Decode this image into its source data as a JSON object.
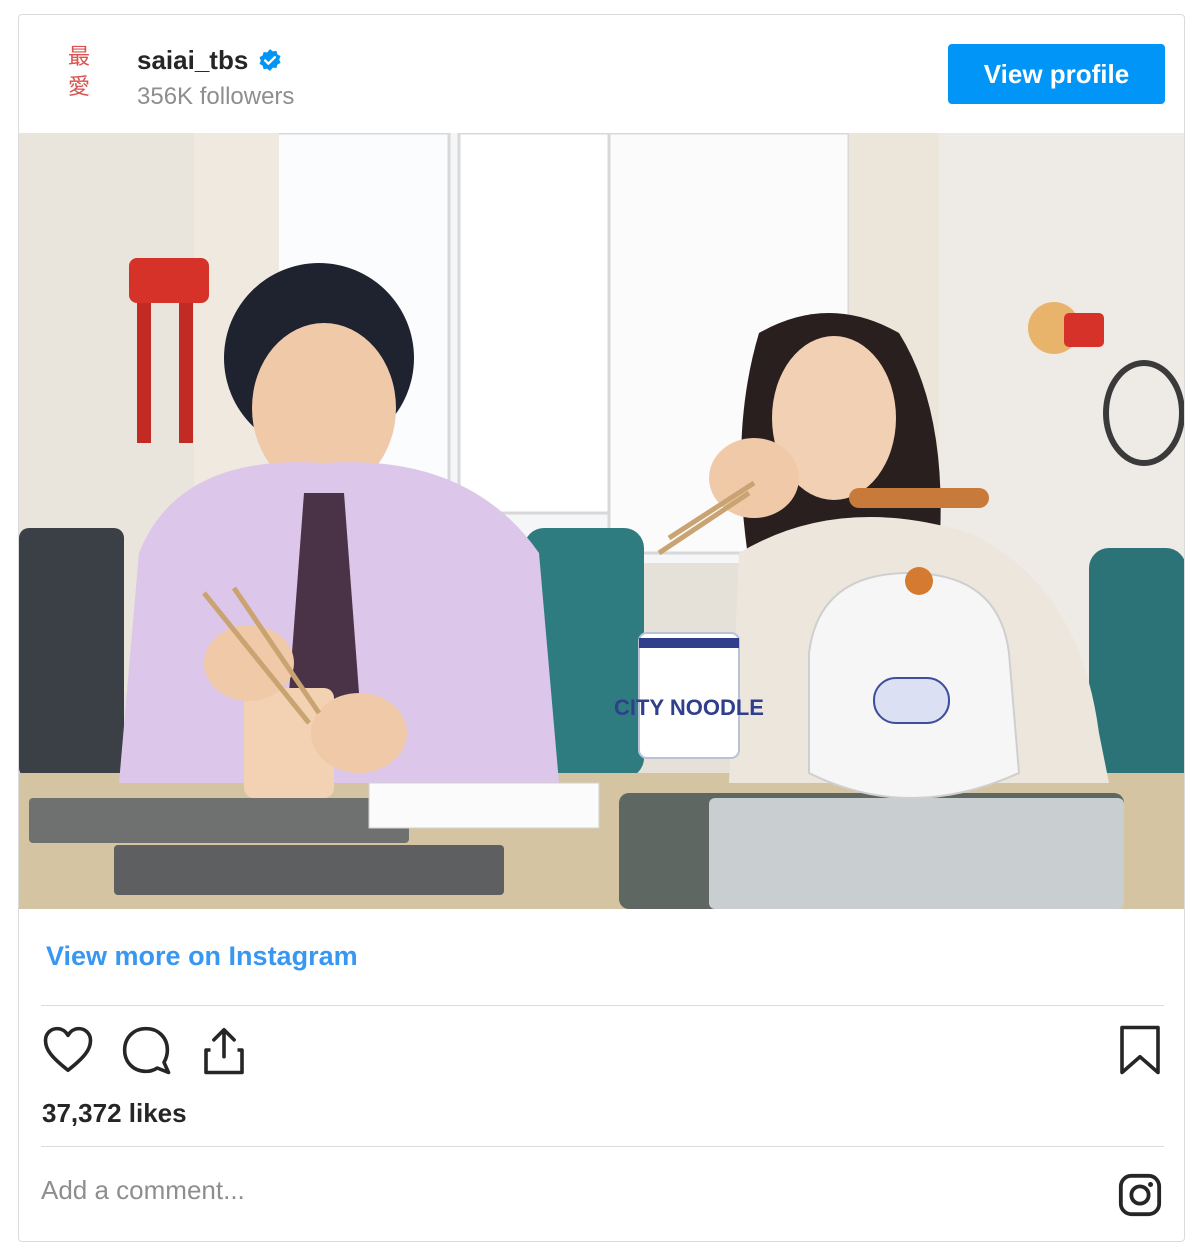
{
  "post": {
    "avatar_chars": [
      "最",
      "愛"
    ],
    "username": "saiai_tbs",
    "followers": "356K followers",
    "view_profile_label": "View profile",
    "photo_text": "CITY NOODLE",
    "view_more_label": "View more on Instagram",
    "likes": "37,372 likes",
    "comment_placeholder": "Add a comment..."
  },
  "icons": {
    "verified": "verified-badge-icon",
    "like": "heart-icon",
    "comment": "comment-bubble-icon",
    "share": "share-icon",
    "save": "bookmark-icon",
    "instagram": "instagram-logo-icon"
  },
  "colors": {
    "accent": "#0095f6",
    "link": "#3897f0",
    "muted": "#8e8e8e",
    "border": "#dbdbdb",
    "text": "#262626"
  }
}
